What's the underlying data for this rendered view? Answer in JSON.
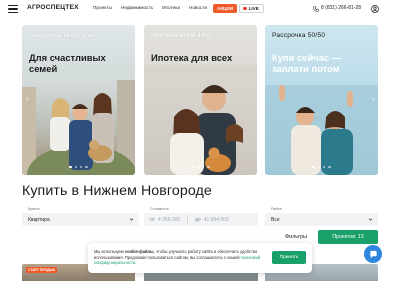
{
  "header": {
    "logo": "АГРОСПЕЦТЕХ",
    "nav": [
      "Проекты",
      "Недвижимость",
      "Ипотека",
      "Новости"
    ],
    "promo_pill": "АКЦИИ",
    "live_pill": "LIVE",
    "phone": "8 (831) 266-81-28"
  },
  "promo_cards": [
    {
      "badge": "Скидки на квартиры",
      "headline": "Для счастливых семей"
    },
    {
      "badge": "Ипотека всем 14%",
      "headline": "Ипотека для всех"
    },
    {
      "badge": "Рассрочка 50/50",
      "headline": "Купи сейчас — заплати потом"
    }
  ],
  "page_title": "Купить в Нижнем Новгороде",
  "filters": {
    "type": {
      "label": "Купить",
      "value": "Квартира"
    },
    "price": {
      "label": "Стоимость",
      "from_prefix": "от",
      "from_value": "4 356 000",
      "to_prefix": "до",
      "to_value": "41 964 000"
    },
    "rooms": {
      "label": "Район",
      "value": "Все"
    },
    "filters_link": "Фильтры",
    "projects_button": "Проектов: 13"
  },
  "tiles": {
    "tag": "СТАРТ ПРОДАЖ"
  },
  "cookie": {
    "text_a": "Мы используем ",
    "text_bold": "cookie-файлы",
    "text_b": ", чтобы улучшить работу сайта и обеспечить удобство использования. Продолжая пользоваться сайтом, вы соглашаетесь с нашей ",
    "link": "политикой конфиденциальности",
    "text_c": ".",
    "accept": "Принять"
  },
  "colors": {
    "accent_green": "#1aa06a",
    "promo_orange": "#ef5a2a",
    "chat_blue": "#2e86de"
  }
}
